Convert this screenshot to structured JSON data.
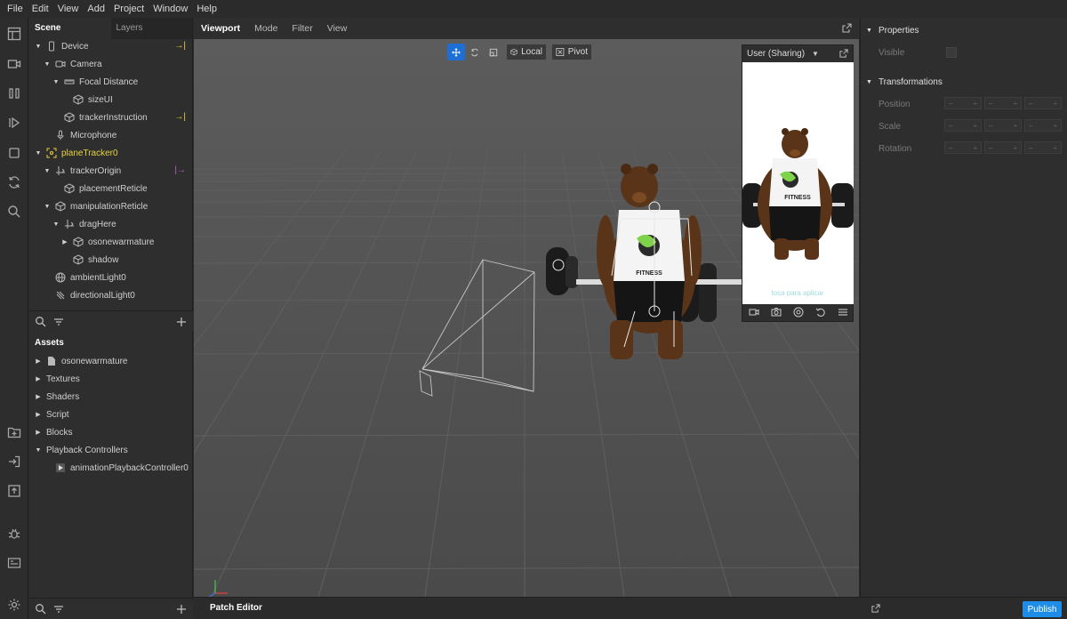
{
  "menu": [
    "File",
    "Edit",
    "View",
    "Add",
    "Project",
    "Window",
    "Help"
  ],
  "scene_tabs": {
    "scene": "Scene",
    "layers": "Layers"
  },
  "scene_tree": [
    {
      "label": "Device",
      "indent": 0,
      "tri": "▼",
      "icon": "phone-icon",
      "badge": "→|",
      "badge_color": "#e8d23c"
    },
    {
      "label": "Camera",
      "indent": 1,
      "tri": "▼",
      "icon": "camera-icon"
    },
    {
      "label": "Focal Distance",
      "indent": 2,
      "tri": "▼",
      "icon": "ruler-icon"
    },
    {
      "label": "sizeUI",
      "indent": 3,
      "tri": "",
      "icon": "cube-icon"
    },
    {
      "label": "trackerInstruction",
      "indent": 2,
      "tri": "",
      "icon": "cube-icon",
      "badge": "→|",
      "badge_color": "#e8d23c"
    },
    {
      "label": "Microphone",
      "indent": 1,
      "tri": "",
      "icon": "microphone-icon"
    },
    {
      "label": "planeTracker0",
      "indent": 0,
      "tri": "▼",
      "icon": "plane-tracker-icon",
      "yellow": true
    },
    {
      "label": "trackerOrigin",
      "indent": 1,
      "tri": "▼",
      "icon": "null-object-icon",
      "badge": "|→",
      "badge_color": "#c25bd6"
    },
    {
      "label": "placementReticle",
      "indent": 2,
      "tri": "",
      "icon": "cube-icon"
    },
    {
      "label": "manipulationReticle",
      "indent": 1,
      "tri": "▼",
      "icon": "cube-icon"
    },
    {
      "label": "dragHere",
      "indent": 2,
      "tri": "▼",
      "icon": "null-object-icon"
    },
    {
      "label": "osonewarmature",
      "indent": 3,
      "tri": "▶",
      "icon": "cube-icon"
    },
    {
      "label": "shadow",
      "indent": 3,
      "tri": "",
      "icon": "cube-icon"
    },
    {
      "label": "ambientLight0",
      "indent": 1,
      "tri": "",
      "icon": "globe-icon"
    },
    {
      "label": "directionalLight0",
      "indent": 1,
      "tri": "",
      "icon": "directional-light-icon"
    }
  ],
  "assets": {
    "title": "Assets",
    "items": [
      {
        "label": "osonewarmature",
        "tri": "▶",
        "icon": "file-icon",
        "indent": 0
      },
      {
        "label": "Textures",
        "tri": "▶",
        "indent": 0
      },
      {
        "label": "Shaders",
        "tri": "▶",
        "indent": 0
      },
      {
        "label": "Script",
        "tri": "▶",
        "indent": 0
      },
      {
        "label": "Blocks",
        "tri": "▶",
        "indent": 0
      },
      {
        "label": "Playback Controllers",
        "tri": "▼",
        "indent": 0
      },
      {
        "label": "animationPlaybackController0",
        "tri": "",
        "icon": "animation-icon",
        "indent": 1
      }
    ]
  },
  "viewport": {
    "tabs": [
      "Viewport",
      "Mode",
      "Filter",
      "View"
    ],
    "tools": {
      "local": "Local",
      "pivot": "Pivot"
    }
  },
  "preview": {
    "title": "User (Sharing)",
    "shirt_text": "FITNESS",
    "hint": "toca para aplicar"
  },
  "properties": {
    "title": "Properties",
    "visible": "Visible",
    "transformations": "Transformations",
    "position": "Position",
    "scale": "Scale",
    "rotation": "Rotation",
    "field_value": "–",
    "field_arrow": "÷"
  },
  "bottom": {
    "patch_editor": "Patch Editor",
    "publish": "Publish"
  },
  "colors": {
    "accent": "#1d8de8",
    "tracker_yellow": "#e8d23c",
    "brown_bear": "#5a3418"
  }
}
